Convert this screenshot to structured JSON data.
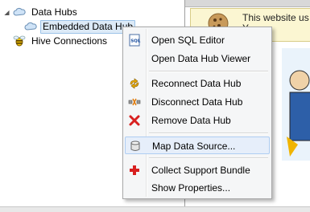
{
  "tree": {
    "data_hubs_label": "Data Hubs",
    "embedded_hub_label": "Embedded Data Hub",
    "hive_connections_label": "Hive Connections"
  },
  "notice": {
    "line1": "This website us",
    "line2": "Y"
  },
  "context_menu": {
    "items": [
      {
        "label": "Open SQL Editor",
        "icon": "sql-editor-icon"
      },
      {
        "label": "Open Data Hub Viewer",
        "icon": ""
      },
      {
        "label": "Reconnect Data Hub",
        "icon": "reconnect-icon"
      },
      {
        "label": "Disconnect Data Hub",
        "icon": "disconnect-icon"
      },
      {
        "label": "Remove Data Hub",
        "icon": "remove-icon"
      },
      {
        "label": "Map Data Source...",
        "icon": "datasource-cylinder-icon"
      },
      {
        "label": "Collect Support Bundle",
        "icon": "support-cross-icon"
      },
      {
        "label": "Show Properties...",
        "icon": ""
      }
    ],
    "highlighted_item": "Map Data Source..."
  },
  "colors": {
    "menu_background": "#f5f6f7",
    "highlight_background": "#e6eefa",
    "selection_background": "#dceaf7",
    "remove_red": "#d82020"
  }
}
